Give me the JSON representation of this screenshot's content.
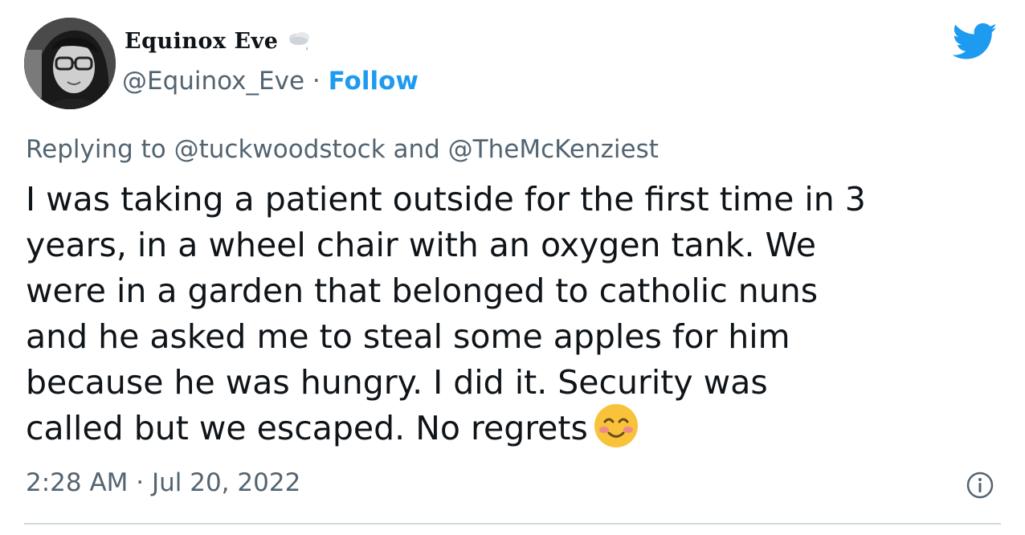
{
  "tweet": {
    "author": {
      "display_name": "Equinox Eve",
      "name_emoji": "cloud-with-rain-icon",
      "handle": "@Equinox_Eve",
      "separator": "·",
      "follow_label": "Follow"
    },
    "replying_to": "Replying to @tuckwoodstock and @TheMcKenziest",
    "body_lines": [
      "I was taking a patient outside for the first time in 3",
      "years, in a wheel chair with an oxygen tank. We",
      "were in a garden that belonged to catholic nuns",
      "and he asked me to steal some apples for him",
      "because he was hungry. I did it. Security was",
      "called but we escaped. No regrets"
    ],
    "body_emoji": "smiling-face-with-blush-icon",
    "timestamp": "2:28 AM · Jul 20, 2022",
    "icons": {
      "brand": "twitter-bird-icon",
      "info": "info-icon"
    },
    "colors": {
      "accent": "#1d9bf0",
      "secondary_text": "#536471",
      "primary_text": "#0f1419",
      "divider": "#cfd9de"
    }
  }
}
